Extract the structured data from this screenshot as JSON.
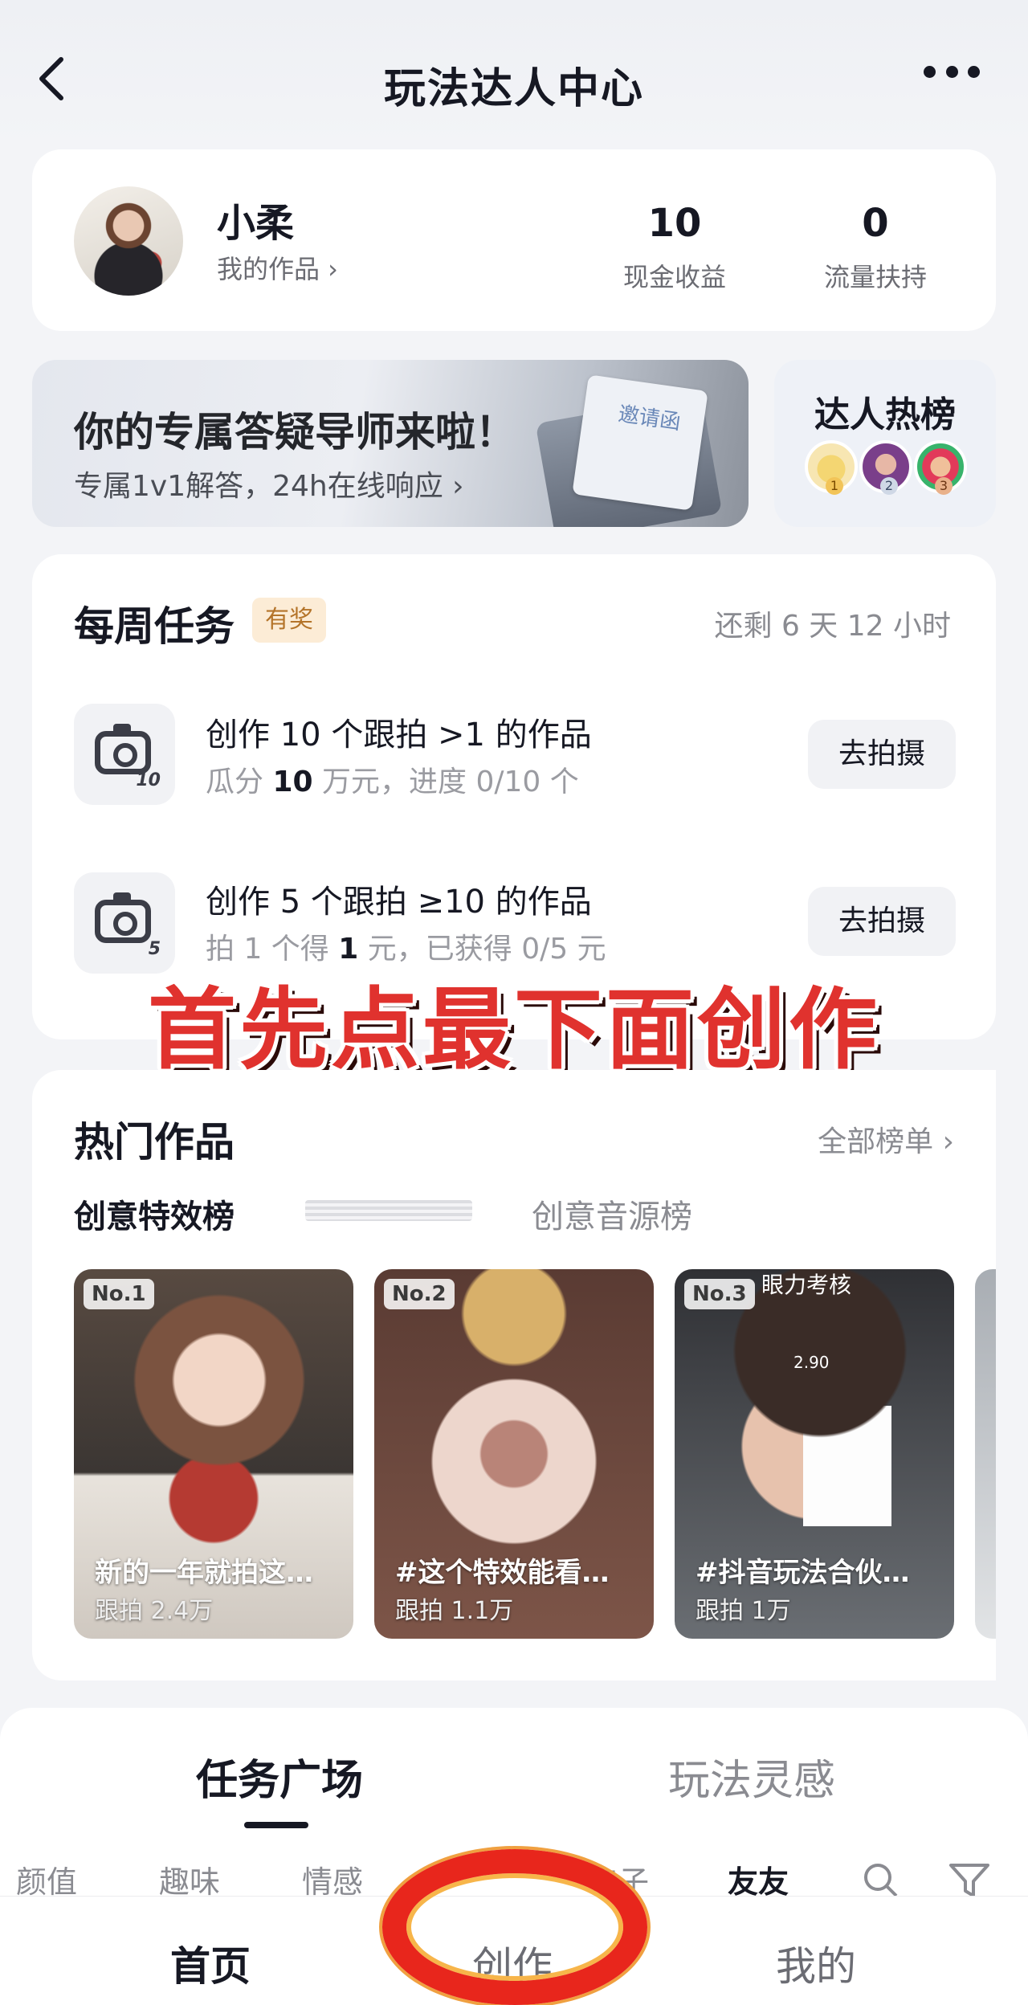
{
  "header": {
    "title": "玩法达人中心"
  },
  "profile": {
    "name": "小柔",
    "works_link": "我的作品 ›",
    "stats": [
      {
        "value": "10",
        "label": "现金收益"
      },
      {
        "value": "0",
        "label": "流量扶持"
      }
    ]
  },
  "banner": {
    "title": "你的专属答疑导师来啦！",
    "subtitle": "专属1v1解答，24h在线响应 ›",
    "envelope_text": "邀请函"
  },
  "hot_list": {
    "title": "达人热榜",
    "ranks": [
      "1",
      "2",
      "3"
    ]
  },
  "weekly": {
    "title": "每周任务",
    "badge": "有奖",
    "remaining": "还剩 6 天 12 小时",
    "tasks": [
      {
        "icon_num": "10",
        "title": "创作 10 个跟拍 >1 的作品",
        "sub_pre": "瓜分 ",
        "sub_bold": "10",
        "sub_post": " 万元，进度 0/10 个",
        "button": "去拍摄"
      },
      {
        "icon_num": "5",
        "title": "创作 5 个跟拍 ≥10 的作品",
        "sub_pre": "拍 1 个得 ",
        "sub_bold": "1",
        "sub_post": " 元，已获得 0/5 元",
        "button": "去拍摄"
      }
    ]
  },
  "overlay_text": "首先点最下面创作",
  "hot_works": {
    "title": "热门作品",
    "all_rank": "全部榜单 ›",
    "tabs": [
      "创意特效榜",
      "创意音源榜"
    ],
    "items": [
      {
        "rank": "No.1",
        "caption": "新的一年就拍这…",
        "count": "跟拍 2.4万"
      },
      {
        "rank": "No.2",
        "caption": "#这个特效能看…",
        "count": "跟拍 1.1万"
      },
      {
        "rank": "No.3",
        "caption": "#抖音玩法合伙…",
        "count": "跟拍 1万",
        "top_text": "眼力考核",
        "number_text": "2.90"
      }
    ]
  },
  "bottom": {
    "tabs": [
      "任务广场",
      "玩法灵感"
    ],
    "categories": [
      "颜值",
      "趣味",
      "情感",
      "亲子",
      "友友"
    ]
  },
  "nav": {
    "items": [
      "首页",
      "创作",
      "我的"
    ]
  }
}
